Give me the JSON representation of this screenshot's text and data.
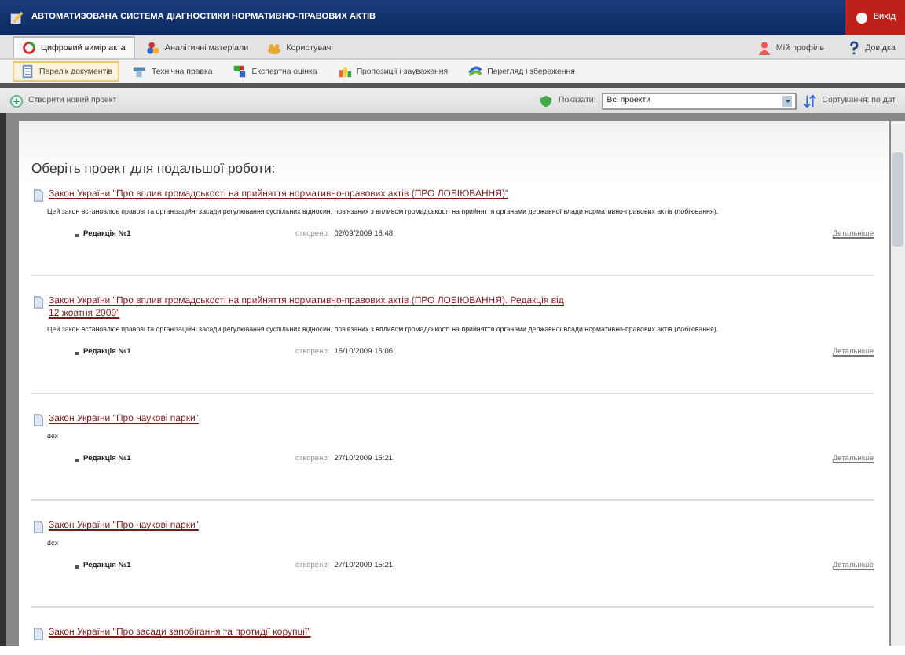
{
  "window": {
    "title": "АВТОМАТИЗОВАНА СИСТЕМА ДІАГНОСТИКИ НОРМАТИВНО-ПРАВОВИХ АКТІВ",
    "logout": "Вихід"
  },
  "main_tabs": [
    {
      "label": "Цифровий вимір акта",
      "selected": true
    },
    {
      "label": "Аналітичні матеріали",
      "selected": false
    },
    {
      "label": "Користувачі",
      "selected": false
    }
  ],
  "user_links": [
    "Мій профіль",
    "Довідка"
  ],
  "sub_tabs": [
    {
      "label": "Перелік документів",
      "selected": true
    },
    {
      "label": "Технічна правка",
      "selected": false
    },
    {
      "label": "Експертна оцінка",
      "selected": false
    },
    {
      "label": "Пропозиції і зауваження",
      "selected": false
    },
    {
      "label": "Перегляд і збереження",
      "selected": false
    }
  ],
  "toolbar": {
    "create": "Створити новий проект",
    "show_label": "Показати:",
    "filter": "Всі проекти",
    "sort": "Сортування: по дат"
  },
  "heading": "Оберіть проект для подальшої роботи:",
  "projects": [
    {
      "title": "Закон України \"Про вплив громадськості на прийняття нормативно-правових актів (ПРО ЛОБІЮВАННЯ)\"",
      "description": "Цей закон встановлює правові та організаційні засади регулювання суспільних відносин, пов'язаних з впливом громадськості на прийняття органами державної влади нормативно-правових актів (лобіювання).",
      "revision": "Редакція №1",
      "created_label": "створено:",
      "created": "02/09/2009 16:48",
      "details": "Детальніше"
    },
    {
      "title": "Закон України \"Про вплив громадськості на прийняття нормативно-правових актів (ПРО ЛОБІЮВАННЯ). Редакція від 12 жовтня 2009\"",
      "description": "Цей закон встановлює правові та організаційні засади регулювання суспільних відносин, пов'язаних з впливом громадськості на прийняття органами державної влади нормативно-правових актів (лобіювання).",
      "revision": "Редакція №1",
      "created_label": "створено:",
      "created": "16/10/2009 16:06",
      "details": "Детальніше"
    },
    {
      "title": "Закон України \"Про наукові парки\"",
      "description": "dex",
      "revision": "Редакція №1",
      "created_label": "створено:",
      "created": "27/10/2009 15:21",
      "details": "Детальніше"
    },
    {
      "title": "Закон України \"Про наукові парки\"",
      "description": "dex",
      "revision": "Редакція №1",
      "created_label": "створено:",
      "created": "27/10/2009 15:21",
      "details": "Детальніше"
    },
    {
      "title": "Закон України \"Про засади запобігання та протидії корупції\""
    }
  ]
}
